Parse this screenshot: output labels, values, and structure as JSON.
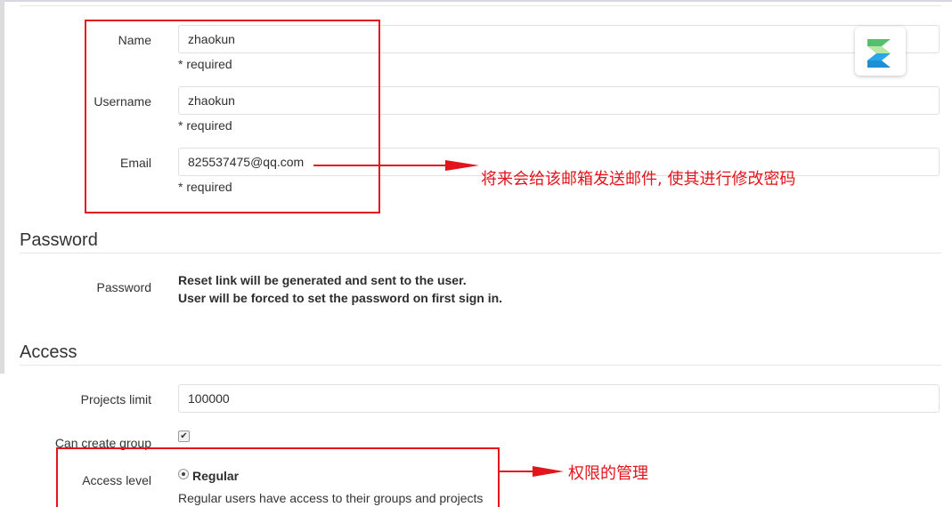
{
  "account": {
    "name": {
      "label": "Name",
      "value": "zhaokun",
      "hint": "* required"
    },
    "username": {
      "label": "Username",
      "value": "zhaokun",
      "hint": "* required"
    },
    "email": {
      "label": "Email",
      "value": "825537475@qq.com",
      "hint": "* required"
    }
  },
  "password": {
    "section_title": "Password",
    "label": "Password",
    "line1": "Reset link will be generated and sent to the user.",
    "line2": "User will be forced to set the password on first sign in."
  },
  "access": {
    "section_title": "Access",
    "projects_limit": {
      "label": "Projects limit",
      "value": "100000"
    },
    "can_create_group": {
      "label": "Can create group",
      "checked": true
    },
    "access_level": {
      "label": "Access level",
      "selected_option": "Regular",
      "description": "Regular users have access to their groups and projects"
    }
  },
  "annotations": {
    "email_note": "将来会给该邮箱发送邮件, 使其进行修改密码",
    "access_note": "权限的管理"
  },
  "colors": {
    "annotation_red": "#e3141b",
    "badge_green": "#54c06e",
    "badge_blue": "#29a6e8"
  }
}
